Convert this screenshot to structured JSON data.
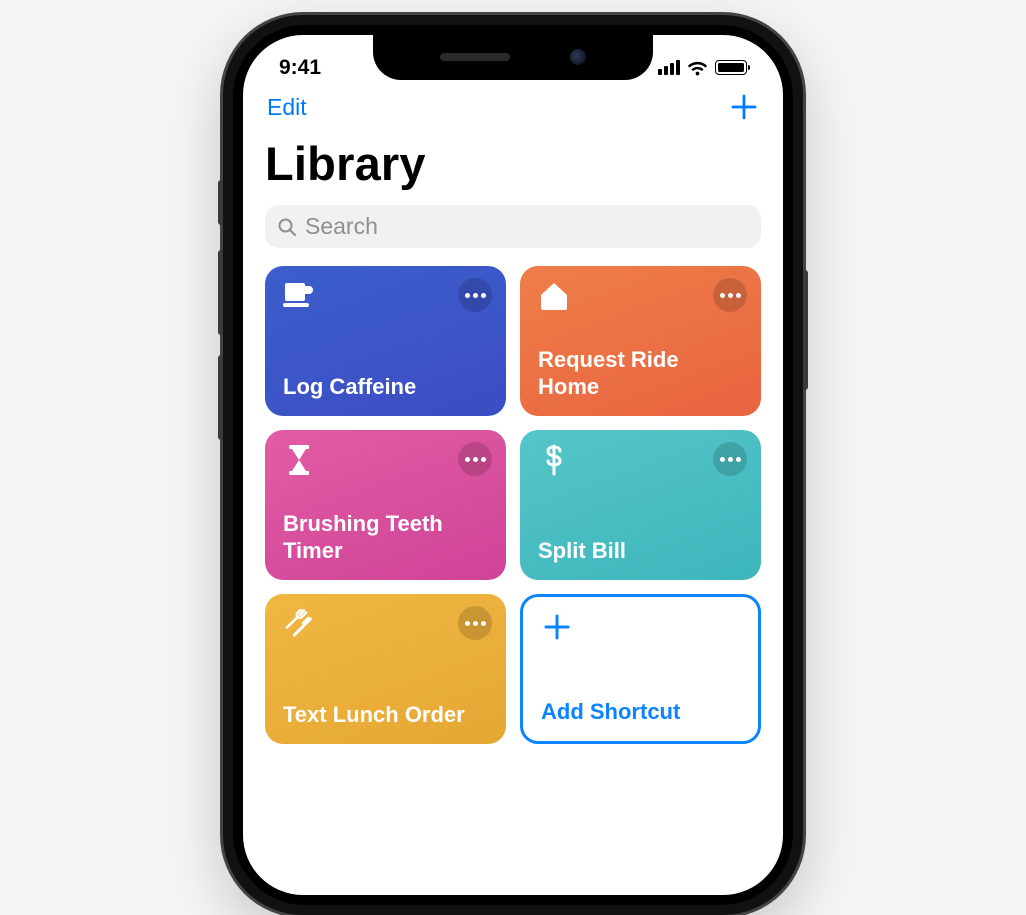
{
  "status": {
    "time": "9:41"
  },
  "nav": {
    "edit_label": "Edit"
  },
  "page": {
    "title": "Library"
  },
  "search": {
    "placeholder": "Search"
  },
  "cards": {
    "log_caffeine": {
      "label": "Log Caffeine",
      "icon": "coffee-icon",
      "color": "blue"
    },
    "request_ride": {
      "label": "Request Ride Home",
      "icon": "home-icon",
      "color": "orange"
    },
    "brush_teeth": {
      "label": "Brushing Teeth Timer",
      "icon": "hourglass-icon",
      "color": "pink"
    },
    "split_bill": {
      "label": "Split Bill",
      "icon": "dollar-icon",
      "color": "teal"
    },
    "text_lunch": {
      "label": "Text Lunch Order",
      "icon": "utensils-icon",
      "color": "yellow"
    },
    "add_shortcut": {
      "label": "Add Shortcut",
      "icon": "plus-icon",
      "color": "add"
    }
  }
}
